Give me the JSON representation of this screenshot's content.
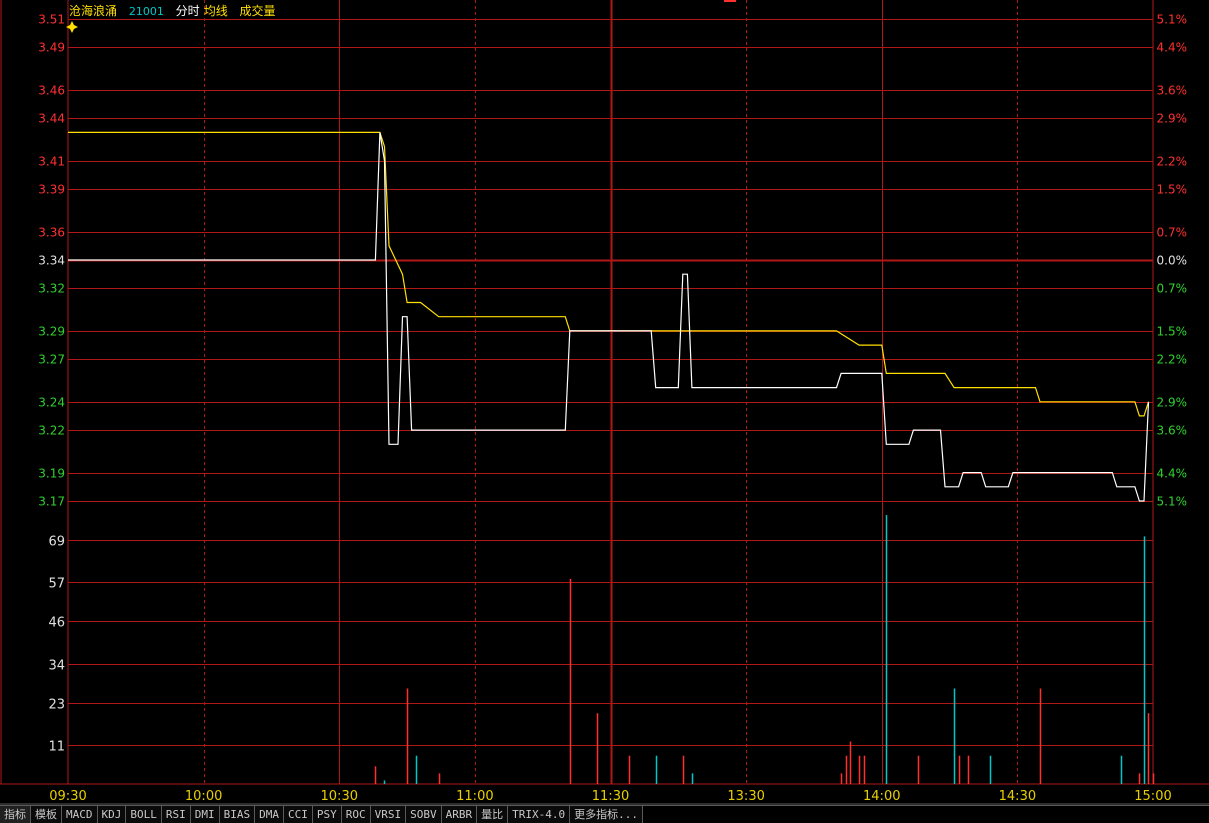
{
  "header": {
    "stock_name": "沧海浪涌",
    "stock_code": "21001",
    "legend_time": "分时",
    "legend_avg": "均线",
    "legend_volume": "成交量"
  },
  "tabs": [
    "指标",
    "模板",
    "MACD",
    "KDJ",
    "BOLL",
    "RSI",
    "DMI",
    "BIAS",
    "DMA",
    "CCI",
    "PSY",
    "ROC",
    "VRSI",
    "SOBV",
    "ARBR",
    "量比",
    "TRIX-4.0",
    "更多指标..."
  ],
  "chart_data": {
    "type": "line",
    "subtype": "intraday-timeshare",
    "prev_close": 3.34,
    "price_ticks": {
      "labels": [
        "3.51",
        "3.49",
        "3.46",
        "3.44",
        "3.41",
        "3.39",
        "3.36",
        "3.34",
        "3.32",
        "3.29",
        "3.27",
        "3.24",
        "3.22",
        "3.19",
        "3.17"
      ],
      "values": [
        3.51,
        3.49,
        3.46,
        3.44,
        3.41,
        3.39,
        3.36,
        3.34,
        3.32,
        3.29,
        3.27,
        3.24,
        3.22,
        3.19,
        3.17
      ],
      "colors": [
        "#ff3030",
        "#ff3030",
        "#ff3030",
        "#ff3030",
        "#ff3030",
        "#ff3030",
        "#ff3030",
        "#e0e0e0",
        "#30d030",
        "#30d030",
        "#30d030",
        "#30d030",
        "#30d030",
        "#30d030",
        "#30d030"
      ]
    },
    "pct_ticks": {
      "labels": [
        "5.1%",
        "4.4%",
        "3.6%",
        "2.9%",
        "2.2%",
        "1.5%",
        "0.7%",
        "0.0%",
        "0.7%",
        "1.5%",
        "2.2%",
        "2.9%",
        "3.6%",
        "4.4%",
        "5.1%"
      ],
      "colors": [
        "#ff3030",
        "#ff3030",
        "#ff3030",
        "#ff3030",
        "#ff3030",
        "#ff3030",
        "#ff3030",
        "#e0e0e0",
        "#30d030",
        "#30d030",
        "#30d030",
        "#30d030",
        "#30d030",
        "#30d030",
        "#30d030"
      ]
    },
    "price_range": [
      3.17,
      3.51
    ],
    "volume_ticks": [
      69,
      57,
      46,
      34,
      23,
      11
    ],
    "volume_range": [
      0,
      80
    ],
    "time_labels": [
      "09:30",
      "10:00",
      "10:30",
      "11:00",
      "11:30",
      "13:30",
      "14:00",
      "14:30",
      "15:00"
    ],
    "session_minutes": 240,
    "price_series": {
      "name": "分时",
      "color": "#ffffff",
      "points": [
        [
          0,
          3.34
        ],
        [
          68,
          3.34
        ],
        [
          69,
          3.43
        ],
        [
          70,
          3.41
        ],
        [
          71,
          3.21
        ],
        [
          73,
          3.21
        ],
        [
          74,
          3.3
        ],
        [
          75,
          3.3
        ],
        [
          76,
          3.22
        ],
        [
          110,
          3.22
        ],
        [
          111,
          3.29
        ],
        [
          129,
          3.29
        ],
        [
          130,
          3.25
        ],
        [
          135,
          3.25
        ],
        [
          136,
          3.33
        ],
        [
          137,
          3.33
        ],
        [
          138,
          3.25
        ],
        [
          170,
          3.25
        ],
        [
          171,
          3.26
        ],
        [
          180,
          3.26
        ],
        [
          181,
          3.21
        ],
        [
          186,
          3.21
        ],
        [
          187,
          3.22
        ],
        [
          193,
          3.22
        ],
        [
          194,
          3.18
        ],
        [
          197,
          3.18
        ],
        [
          198,
          3.19
        ],
        [
          202,
          3.19
        ],
        [
          203,
          3.18
        ],
        [
          208,
          3.18
        ],
        [
          209,
          3.19
        ],
        [
          231,
          3.19
        ],
        [
          232,
          3.18
        ],
        [
          236,
          3.18
        ],
        [
          237,
          3.17
        ],
        [
          238,
          3.17
        ],
        [
          239,
          3.24
        ]
      ]
    },
    "avg_series": {
      "name": "均线",
      "color": "#ffe000",
      "points": [
        [
          0,
          3.43
        ],
        [
          69,
          3.43
        ],
        [
          70,
          3.42
        ],
        [
          71,
          3.35
        ],
        [
          74,
          3.33
        ],
        [
          75,
          3.31
        ],
        [
          78,
          3.31
        ],
        [
          82,
          3.3
        ],
        [
          110,
          3.3
        ],
        [
          111,
          3.29
        ],
        [
          130,
          3.29
        ],
        [
          131,
          3.29
        ],
        [
          170,
          3.29
        ],
        [
          175,
          3.28
        ],
        [
          180,
          3.28
        ],
        [
          181,
          3.26
        ],
        [
          194,
          3.26
        ],
        [
          196,
          3.25
        ],
        [
          202,
          3.25
        ],
        [
          205,
          3.25
        ],
        [
          214,
          3.25
        ],
        [
          215,
          3.24
        ],
        [
          236,
          3.24
        ],
        [
          237,
          3.23
        ],
        [
          238,
          3.23
        ],
        [
          239,
          3.24
        ]
      ]
    },
    "volume_bars": [
      {
        "t": 68,
        "v": 5,
        "c": "#ff3030"
      },
      {
        "t": 70,
        "v": 1,
        "c": "#00c8c8"
      },
      {
        "t": 75,
        "v": 27,
        "c": "#ff3030"
      },
      {
        "t": 77,
        "v": 8,
        "c": "#00c8c8"
      },
      {
        "t": 82,
        "v": 3,
        "c": "#ff3030"
      },
      {
        "t": 111,
        "v": 58,
        "c": "#ff3030"
      },
      {
        "t": 117,
        "v": 20,
        "c": "#ff3030"
      },
      {
        "t": 124,
        "v": 8,
        "c": "#ff3030"
      },
      {
        "t": 130,
        "v": 8,
        "c": "#00c8c8"
      },
      {
        "t": 136,
        "v": 8,
        "c": "#ff3030"
      },
      {
        "t": 138,
        "v": 3,
        "c": "#00c8c8"
      },
      {
        "t": 171,
        "v": 3,
        "c": "#ff3030"
      },
      {
        "t": 172,
        "v": 8,
        "c": "#ff3030"
      },
      {
        "t": 173,
        "v": 12,
        "c": "#ff3030"
      },
      {
        "t": 175,
        "v": 8,
        "c": "#ff3030"
      },
      {
        "t": 176,
        "v": 8,
        "c": "#ff3030"
      },
      {
        "t": 181,
        "v": 76,
        "c": "#00c8c8"
      },
      {
        "t": 188,
        "v": 8,
        "c": "#ff3030"
      },
      {
        "t": 196,
        "v": 27,
        "c": "#00c8c8"
      },
      {
        "t": 197,
        "v": 8,
        "c": "#ff3030"
      },
      {
        "t": 199,
        "v": 8,
        "c": "#ff3030"
      },
      {
        "t": 204,
        "v": 8,
        "c": "#00c8c8"
      },
      {
        "t": 215,
        "v": 27,
        "c": "#ff3030"
      },
      {
        "t": 233,
        "v": 8,
        "c": "#00c8c8"
      },
      {
        "t": 237,
        "v": 3,
        "c": "#ff3030"
      },
      {
        "t": 238,
        "v": 70,
        "c": "#00c8c8"
      },
      {
        "t": 239,
        "v": 20,
        "c": "#ff3030"
      },
      {
        "t": 240,
        "v": 3,
        "c": "#ff3030"
      }
    ],
    "grid": true,
    "colors": {
      "background": "#000000",
      "grid": "#b01818",
      "up": "#ff3030",
      "down": "#30d030",
      "flat": "#e0e0e0",
      "axis_time": "#e8d000"
    }
  }
}
